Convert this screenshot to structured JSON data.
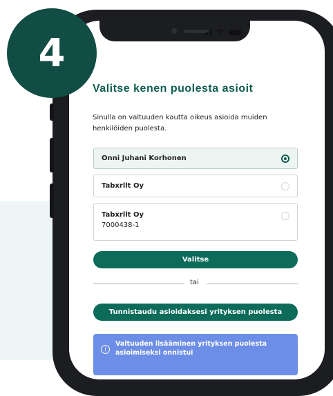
{
  "step_number": "4",
  "page": {
    "title": "Valitse kenen puolesta asioit",
    "description": "Sinulla on valtuuden kautta oikeus asioida muiden henkilöiden puolesta."
  },
  "options": [
    {
      "name": "Onni Juhani Korhonen",
      "selected": true
    },
    {
      "name": "Tabxrllt Oy",
      "selected": false
    },
    {
      "name": "Tabxrllt Oy",
      "code": "7000438-1",
      "selected": false
    }
  ],
  "actions": {
    "select_label": "Valitse",
    "divider_label": "tai",
    "company_auth_label": "Tunnistaudu asioidaksesi yrityksen puolesta"
  },
  "notice": {
    "icon": "info-icon",
    "message": "Valtuuden lisääminen yrityksen puolesta asioimiseksi onnistui"
  },
  "colors": {
    "primary": "#0d6b5a",
    "step_badge": "#114d44",
    "notice": "#6d8ee6"
  }
}
